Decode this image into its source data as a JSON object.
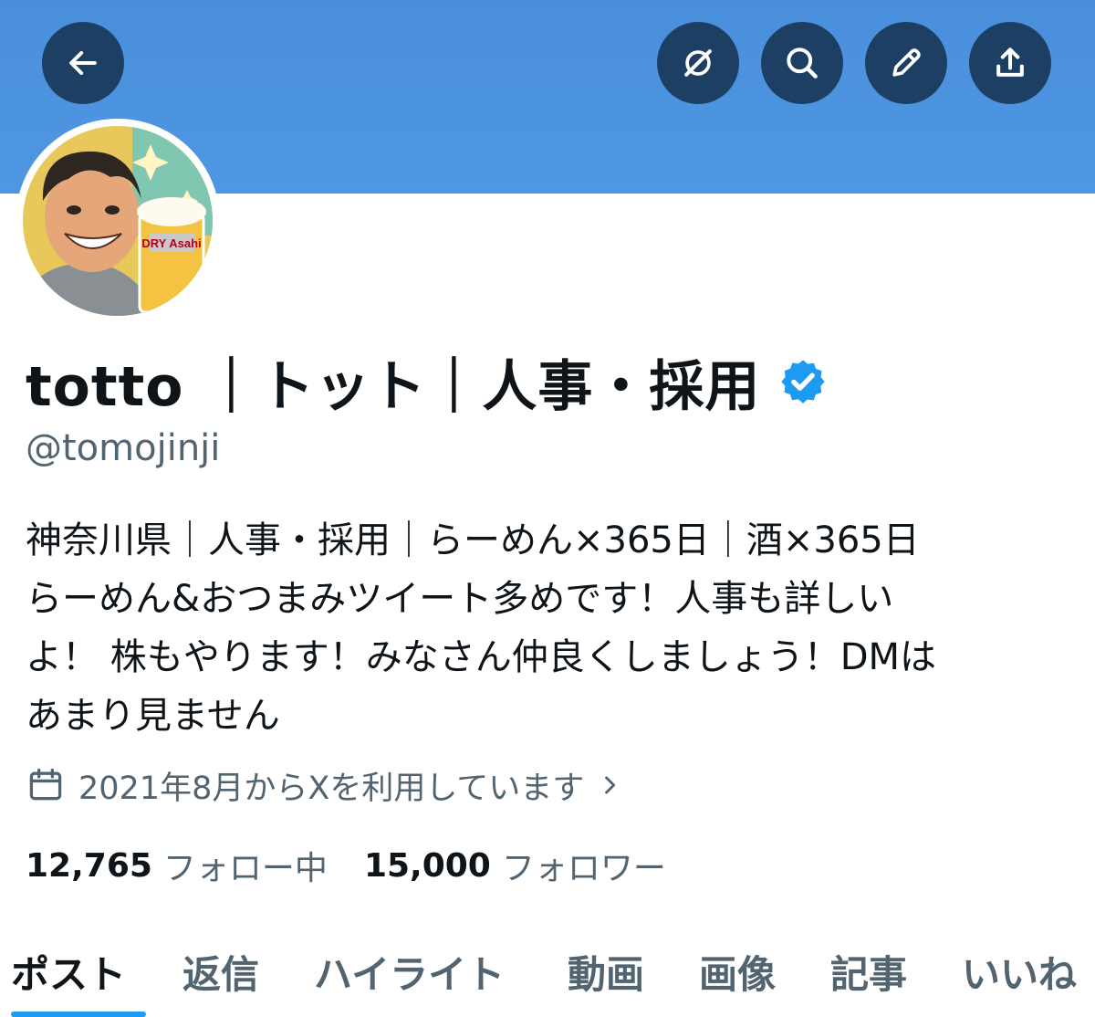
{
  "profile": {
    "display_name": "totto ｜トット｜人事・採用",
    "handle": "@tomojinji",
    "verified": true,
    "bio": "神奈川県｜人事・採用｜らーめん×365日｜酒×365日\nらーめん&おつまみツイート多めです！人事も詳しい\nよ！ 株もやります！みなさん仲良くしましょう！DMは\nあまり見ません",
    "joined": "2021年8月からXを利用しています",
    "avatar_text": "DRY Asahi"
  },
  "stats": {
    "following_count": "12,765",
    "following_label": "フォロー中",
    "followers_count": "15,000",
    "followers_label": "フォロワー"
  },
  "tabs": [
    {
      "label": "ポスト",
      "active": true
    },
    {
      "label": "返信"
    },
    {
      "label": "ハイライト"
    },
    {
      "label": "動画"
    },
    {
      "label": "画像"
    },
    {
      "label": "記事"
    },
    {
      "label": "いいね"
    }
  ],
  "icons": {
    "back": "back-arrow-icon",
    "grok": "grok-icon",
    "search": "search-icon",
    "edit": "pencil-icon",
    "share": "share-icon",
    "calendar": "calendar-icon",
    "chevron": "chevron-right-icon",
    "verified": "verified-badge-icon"
  },
  "colors": {
    "banner": "#4a8fdb",
    "button_bg": "#1d3f63",
    "accent": "#1d9bf0",
    "secondary_text": "#536471"
  }
}
